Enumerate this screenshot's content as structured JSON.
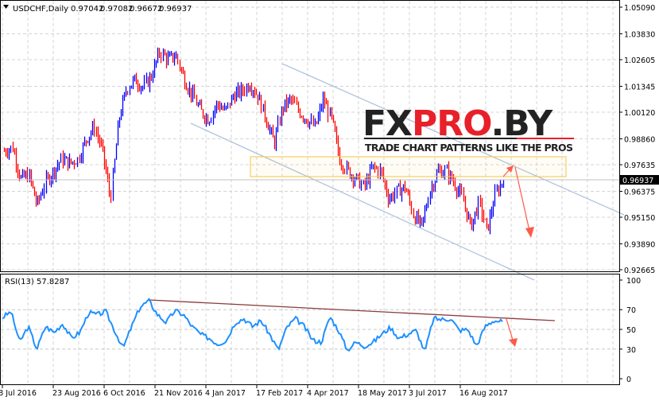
{
  "header": {
    "symbol": "USDCHF,Daily",
    "open": "0.97042",
    "high": "0.97082",
    "low": "0.96672",
    "close": "0.96937"
  },
  "rsi_label": "RSI(13) 57.8287",
  "logo": {
    "brand_dark1": "FX",
    "brand_red": "PRO",
    "brand_dark2": ".BY",
    "tagline": "TRADE CHART PATTERNS LIKE THE PROS"
  },
  "colors": {
    "bull": "#0000ff",
    "bear": "#ff0000",
    "rsi": "#1e90ff",
    "channel": "#b0c4de",
    "rsi_trend": "#8b3a3a",
    "arrow": "#ff5a4a",
    "zone": "#f5c542"
  },
  "chart_data": [
    {
      "type": "bar",
      "title": "USDCHF,Daily",
      "price_ticks": [
        "1.05090",
        "1.03830",
        "1.02605",
        "1.01345",
        "1.00120",
        "0.98860",
        "0.97635",
        "0.96375",
        "0.95150",
        "0.93890",
        "0.92665"
      ],
      "ylim": [
        0.92665,
        1.0509
      ],
      "current_price": "0.96937",
      "closes": [
        0.9828,
        0.9846,
        0.9696,
        0.9715,
        0.9572,
        0.9677,
        0.9733,
        0.979,
        0.9771,
        0.979,
        0.9884,
        0.9941,
        0.9828,
        0.9602,
        0.9978,
        1.0129,
        1.0166,
        1.0129,
        1.0185,
        1.0298,
        1.0261,
        1.0279,
        1.0166,
        1.0091,
        1.0016,
        0.9978,
        1.0053,
        1.0016,
        1.0091,
        1.011,
        1.0148,
        1.0091,
        0.9978,
        0.9865,
        1.0035,
        1.0072,
        1.0016,
        0.9978,
        0.9941,
        1.0072,
        0.9978,
        0.979,
        0.9733,
        0.9696,
        0.9658,
        0.9752,
        0.9733,
        0.9602,
        0.9639,
        0.9658,
        0.9526,
        0.947,
        0.9639,
        0.9733,
        0.9733,
        0.9677,
        0.9602,
        0.947,
        0.9583,
        0.9451,
        0.9621,
        0.9694
      ],
      "x_ticks": [
        "8 Jul 2016",
        "23 Aug 2016",
        "6 Oct 2016",
        "21 Nov 2016",
        "4 Jan 2017",
        "17 Feb 2017",
        "4 Apr 2017",
        "18 May 2017",
        "3 Jul 2017",
        "16 Aug 2017"
      ]
    },
    {
      "type": "line",
      "title": "RSI(13) 57.8287",
      "y_ticks": [
        "100",
        "70",
        "50",
        "30",
        "0"
      ],
      "ylim": [
        0,
        100
      ],
      "values": [
        62,
        68,
        37,
        53,
        30,
        53,
        47,
        56,
        41,
        47,
        67,
        65,
        68,
        49,
        31,
        53,
        73,
        79,
        65,
        57,
        69,
        65,
        53,
        45,
        41,
        35,
        39,
        57,
        61,
        53,
        59,
        45,
        29,
        52,
        61,
        53,
        39,
        37,
        63,
        49,
        29,
        37,
        33,
        37,
        45,
        52,
        41,
        45,
        49,
        27,
        61,
        60,
        61,
        49,
        50,
        33,
        53,
        59,
        57.8
      ]
    }
  ]
}
